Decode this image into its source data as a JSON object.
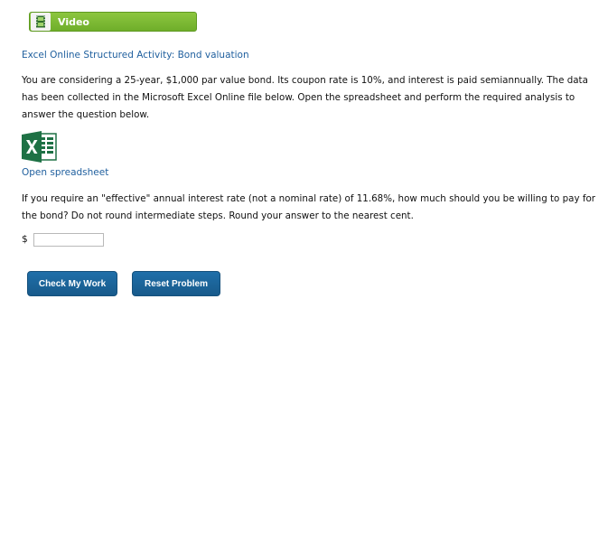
{
  "video": {
    "label": "Video",
    "icon": "film-icon"
  },
  "activity": {
    "title": "Excel Online Structured Activity: Bond valuation"
  },
  "prompt": {
    "text": "You are considering a 25-year, $1,000 par value bond. Its coupon rate is 10%, and interest is paid semiannually. The data has been collected in the Microsoft Excel Online file below. Open the spreadsheet and perform the required analysis to answer the question below."
  },
  "spreadsheet": {
    "icon": "excel-icon",
    "link_label": "Open spreadsheet"
  },
  "question": {
    "text": "If you require an \"effective\" annual interest rate (not a nominal rate) of 11.68%, how much should you be willing to pay for the bond? Do not round intermediate steps. Round your answer to the nearest cent."
  },
  "answer": {
    "currency": "$",
    "value": ""
  },
  "buttons": {
    "check": "Check My Work",
    "reset": "Reset Problem"
  },
  "colors": {
    "video_green": "#7cb935",
    "link_blue": "#1f5f9e",
    "button_blue": "#1f6fa9",
    "excel_green": "#1e7145"
  }
}
